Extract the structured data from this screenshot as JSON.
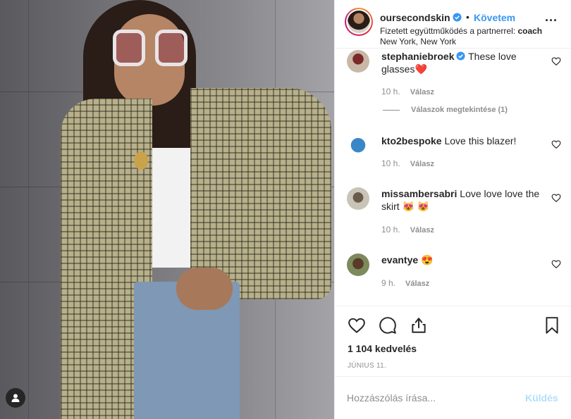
{
  "post": {
    "username": "oursecondskin",
    "follow_label": "Követem",
    "dot": "•",
    "partner_prefix": "Fizetett együttműködés a partnerrel:",
    "partner_name": "coach",
    "location": "New York, New York",
    "more_label": "..."
  },
  "comments": [
    {
      "username": "stephaniebroek",
      "verified": true,
      "text": "These love glasses❤️",
      "time": "10 h.",
      "reply_label": "Válasz",
      "view_replies": "Válaszok megtekintése (1)"
    },
    {
      "username": "kto2bespoke",
      "verified": false,
      "text": "Love this blazer!",
      "time": "10 h.",
      "reply_label": "Válasz"
    },
    {
      "username": "missambersabri",
      "verified": false,
      "text": "Love love love the skirt 😻 😻",
      "time": "10 h.",
      "reply_label": "Válasz"
    },
    {
      "username": "evantye",
      "verified": false,
      "text": "😍",
      "time": "9 h.",
      "reply_label": "Válasz"
    }
  ],
  "stats": {
    "likes": "1 104 kedvelés",
    "date": "JÚNIUS 11."
  },
  "add_comment": {
    "placeholder": "Hozzászólás írása...",
    "post_label": "Küldés"
  },
  "colors": {
    "accent": "#3897f0",
    "muted": "#8e8e8e",
    "text": "#262626",
    "post_disabled": "#b2dffc"
  },
  "icons": [
    "verified-icon",
    "more-icon",
    "heart-icon",
    "comment-icon",
    "share-icon",
    "bookmark-icon",
    "user-tag-icon"
  ]
}
